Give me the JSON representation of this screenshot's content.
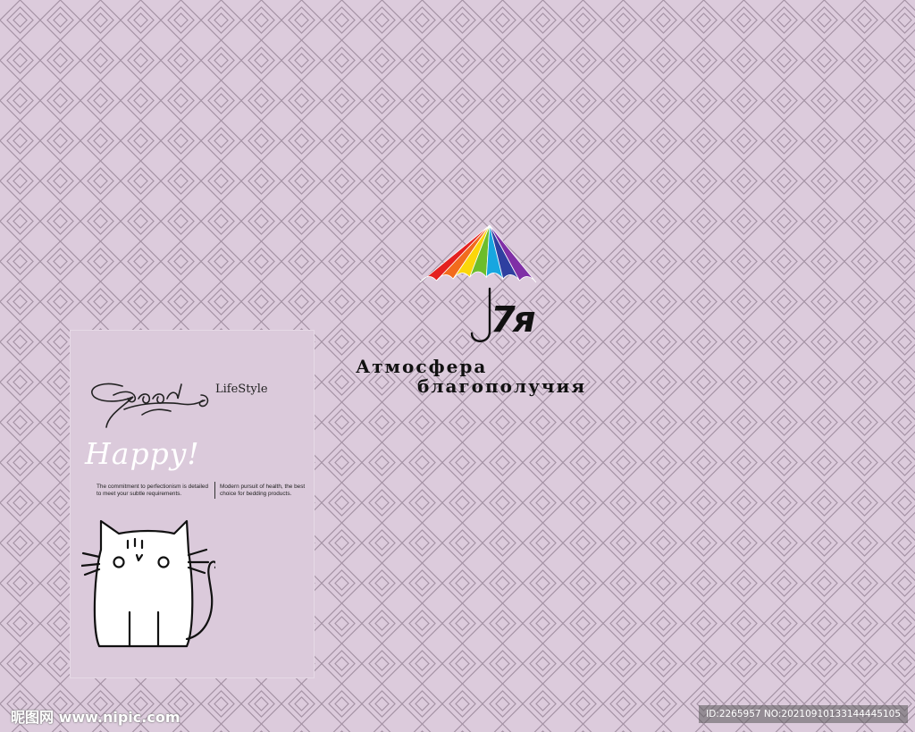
{
  "background": {
    "color": "#dccbdc",
    "pattern_color": "#a492a4",
    "pattern_icon": "diamond-lattice"
  },
  "card": {
    "signature_icon": "signature-flourish",
    "signature_subtitle": "LifeStyle",
    "headline": "Happy!",
    "tagline_left": "The commitment to perfectionism is detailed to meet your subtle requirements.",
    "tagline_right": "Modern pursuit of health, the best choice for bedding products.",
    "illustration_icon": "cat-doodle"
  },
  "logo": {
    "icon": "rainbow-umbrella-icon",
    "brand": "7я",
    "slogan_line1": "Атмосфера",
    "slogan_line2": "благополучия",
    "umbrella_colors": [
      "#e4201f",
      "#f26b1d",
      "#fbd60a",
      "#6cbd2b",
      "#17a6e0",
      "#2f3fa0",
      "#7f2fa6"
    ]
  },
  "watermark": {
    "site": "昵图网 www.nipic.com",
    "id_text": "ID:2265957 NO:20210910133144445105"
  }
}
